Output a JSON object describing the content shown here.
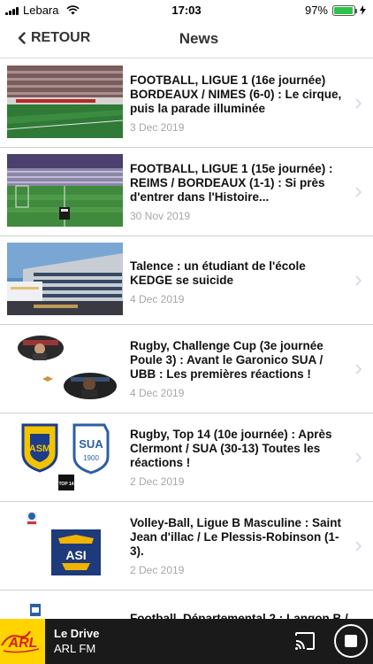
{
  "status_bar": {
    "carrier": "Lebara",
    "time": "17:03",
    "battery": "97%",
    "battery_level": 0.97
  },
  "nav": {
    "back_label": "RETOUR",
    "title": "News"
  },
  "news": [
    {
      "title": "FOOTBALL, LIGUE 1 (16e journée) BORDEAUX / NIMES (6-0) : Le cirque, puis la parade illuminée",
      "date": "3 Dec 2019"
    },
    {
      "title": "FOOTBALL, LIGUE 1 (15e journée) : REIMS / BORDEAUX (1-1) : Si près d'entrer dans l'Histoire...",
      "date": "30 Nov 2019"
    },
    {
      "title": "Talence : un étudiant de l'école KEDGE se suicide",
      "date": "4 Dec 2019"
    },
    {
      "title": "Rugby, Challenge Cup (3e journée Poule 3) : Avant le Garonico SUA / UBB : Les premières réactions !",
      "date": "4 Dec 2019"
    },
    {
      "title": "Rugby, Top 14 (10e journée) : Après Clermont / SUA (30-13) Toutes les réactions !",
      "date": "2 Dec 2019"
    },
    {
      "title": "Volley-Ball, Ligue B Masculine : Saint Jean d'illac / Le Plessis-Robinson (1-3).",
      "date": "2 Dec 2019"
    },
    {
      "title": "Football, Départemental 2 : Langon B / ...",
      "date": ""
    }
  ],
  "logos": {
    "top14": "TOP 14",
    "sua": "SUA",
    "sua_year": "1900",
    "asi": "ASI",
    "arl": "ARL"
  },
  "player": {
    "title": "Le Drive",
    "subtitle": "ARL FM"
  },
  "colors": {
    "accent": "#2fc24a",
    "player_bg": "#1a1a1a",
    "station_logo_bg": "#ffd400",
    "date_text": "#a7a7a7"
  }
}
